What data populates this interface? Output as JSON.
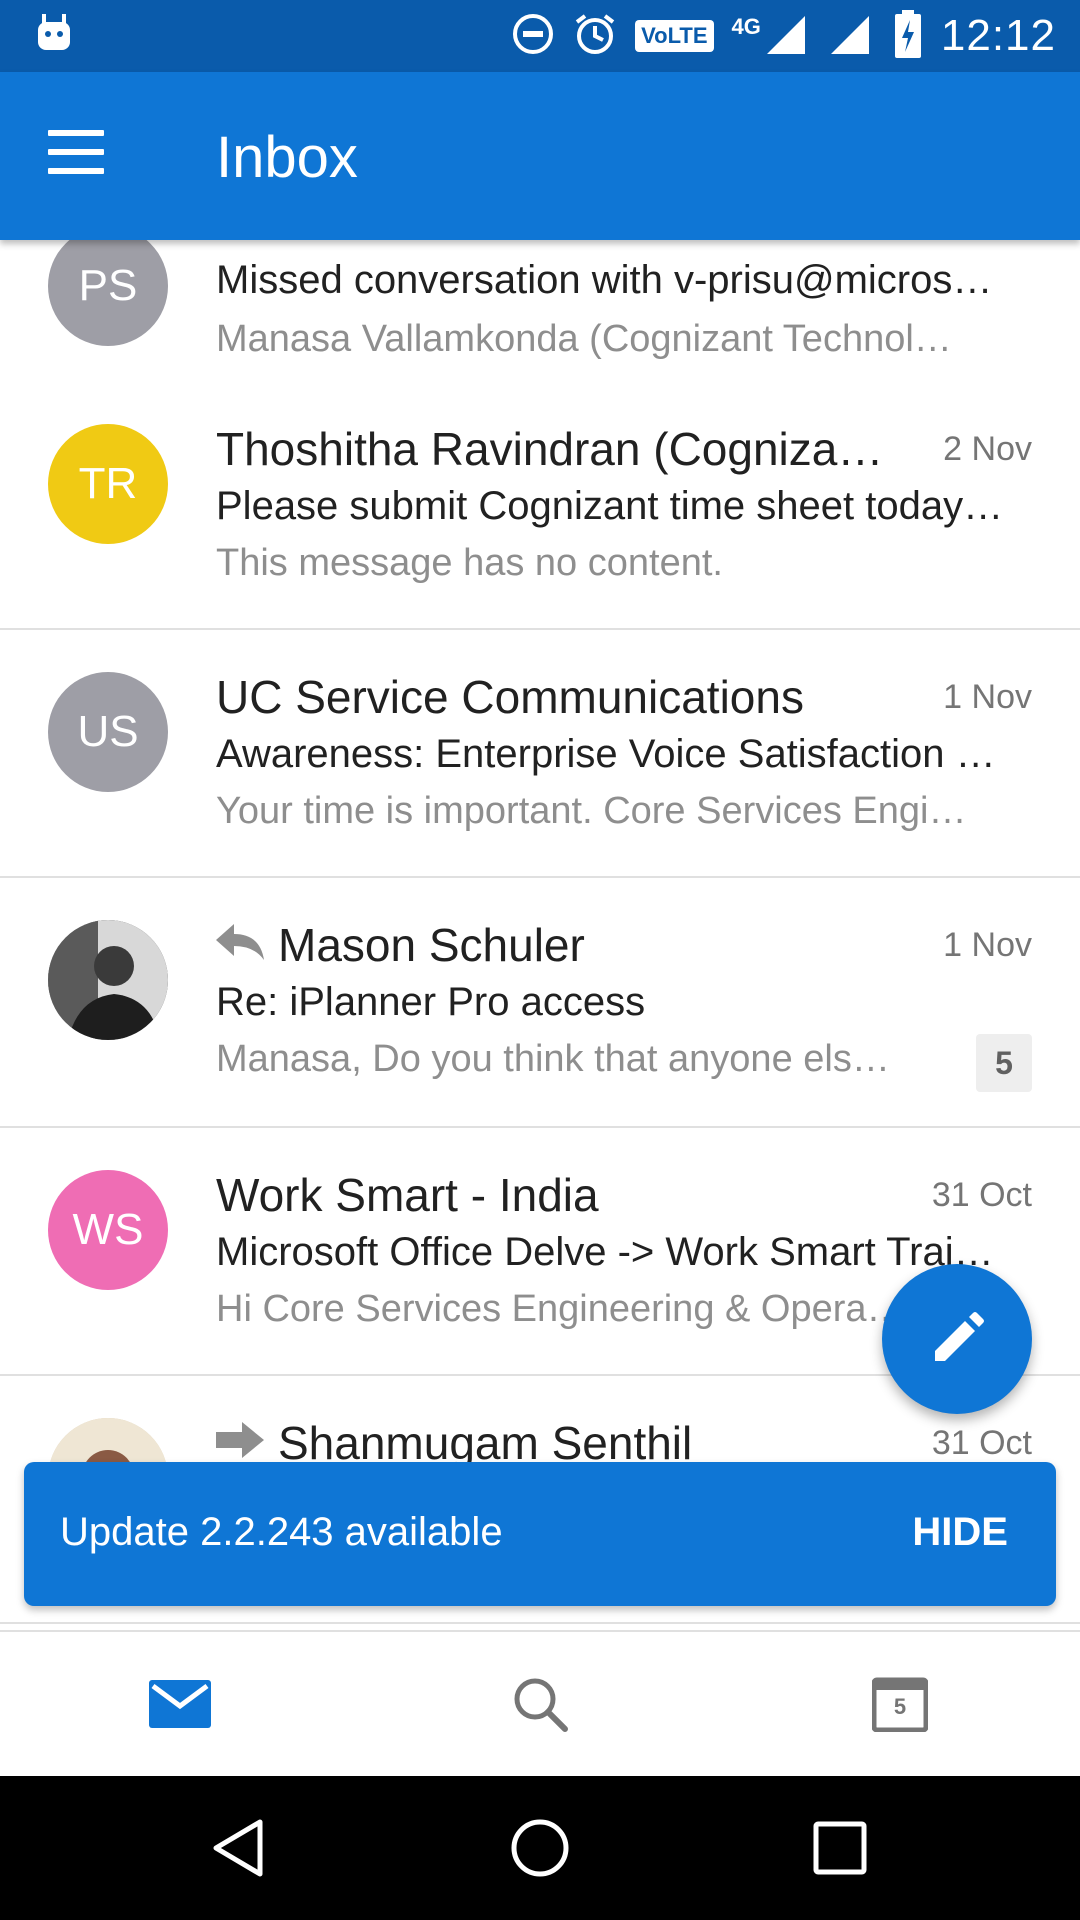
{
  "status_bar": {
    "time": "12:12",
    "volte": "VoLTE",
    "network": "4G"
  },
  "app_bar": {
    "title": "Inbox"
  },
  "messages": [
    {
      "initials": "PS",
      "avatar_color": "#9e9ea6",
      "sender": "",
      "date": "",
      "subject": "Missed conversation with v-prisu@micros…",
      "preview": "Manasa Vallamkonda (Cognizant Technol…"
    },
    {
      "initials": "TR",
      "avatar_color": "#f0ca14",
      "sender": "Thoshitha Ravindran (Cogniza…",
      "date": "2 Nov",
      "subject": "Please submit Cognizant time sheet today…",
      "preview": "This message has no content."
    },
    {
      "initials": "US",
      "avatar_color": "#9e9ea6",
      "sender": "UC Service Communications",
      "date": "1 Nov",
      "subject": "Awareness: Enterprise Voice Satisfaction …",
      "preview": "Your time is important. Core Services Engi…"
    },
    {
      "initials": "",
      "avatar_color": "#2b2b2b",
      "sender": "Mason Schuler",
      "date": "1 Nov",
      "subject": "Re: iPlanner Pro access",
      "preview": "Manasa, Do you think that anyone els…",
      "thread_count": "5",
      "icon": "reply-icon"
    },
    {
      "initials": "WS",
      "avatar_color": "#ef6db4",
      "sender": "Work Smart - India",
      "date": "31 Oct",
      "subject": "Microsoft Office Delve -> Work Smart Trai…",
      "preview": "Hi Core Services Engineering & Opera…"
    },
    {
      "initials": "",
      "avatar_color": "#d9c8a8",
      "sender": "Shanmugam Senthil",
      "date": "31 Oct",
      "subject": "",
      "preview": "",
      "icon": "forward-icon"
    }
  ],
  "snackbar": {
    "text": "Update 2.2.243 available",
    "action": "HIDE"
  },
  "bottom_nav": {
    "calendar_day": "5",
    "active_color": "#0f76d5",
    "inactive_color": "#757575"
  }
}
